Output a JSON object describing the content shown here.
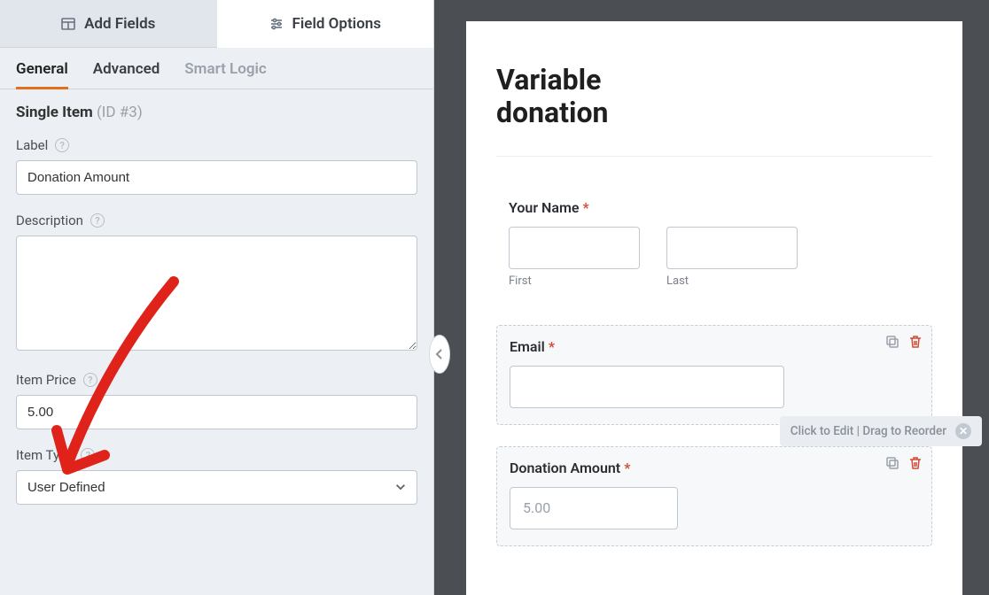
{
  "topTabs": {
    "add": "Add Fields",
    "options": "Field Options"
  },
  "subTabs": {
    "general": "General",
    "advanced": "Advanced",
    "smart": "Smart Logic"
  },
  "section": {
    "title": "Single Item",
    "id": "(ID #3)"
  },
  "labels": {
    "label": "Label",
    "description": "Description",
    "itemPrice": "Item Price",
    "itemType": "Item Type"
  },
  "values": {
    "label": "Donation Amount",
    "description": "",
    "price": "5.00",
    "itemType": "User Defined"
  },
  "preview": {
    "title_l1": "Variable",
    "title_l2": "donation",
    "nameLabel": "Your Name",
    "first": "First",
    "last": "Last",
    "emailLabel": "Email",
    "donationLabel": "Donation Amount",
    "donationPlaceholder": "5.00",
    "hint": "Click to Edit | Drag to Reorder"
  }
}
